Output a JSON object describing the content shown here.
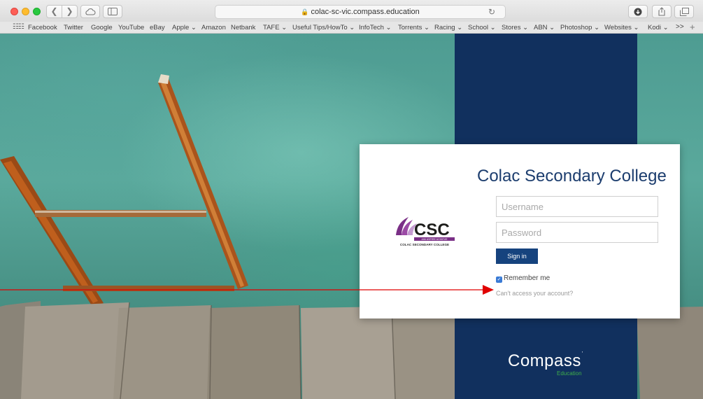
{
  "browser": {
    "url": "colac-sc-vic.compass.education",
    "bookmarks": [
      "Facebook",
      "Twitter",
      "Google",
      "YouTube",
      "eBay",
      "Apple ⌄",
      "Amazon",
      "Netbank",
      "TAFE ⌄",
      "Useful Tips/HowTo ⌄",
      "InfoTech ⌄",
      "Torrents ⌄",
      "Racing ⌄",
      "School ⌄",
      "Stores ⌄",
      "ABN ⌄",
      "Photoshop ⌄",
      "Websites ⌄",
      "Kodi ⌄"
    ],
    "bookmarks_more": ">>",
    "bookmarks_add": "+"
  },
  "login": {
    "college_name": "Colac Secondary College",
    "logo": {
      "abbrev": "CSC",
      "tagline": "AIM ASPIRE ACHIEVE",
      "subtitle": "COLAC SECONDARY COLLEGE"
    },
    "username_placeholder": "Username",
    "password_placeholder": "Password",
    "signin_label": "Sign in",
    "remember_label": "Remember me",
    "remember_checked": true,
    "cant_access": "Can't access your account?"
  },
  "brand": {
    "name": "Compass",
    "sub": "Education"
  },
  "colors": {
    "navy": "#11305e",
    "signin": "#16437e",
    "compass_green": "#3fae49",
    "annotation": "#e00000"
  }
}
